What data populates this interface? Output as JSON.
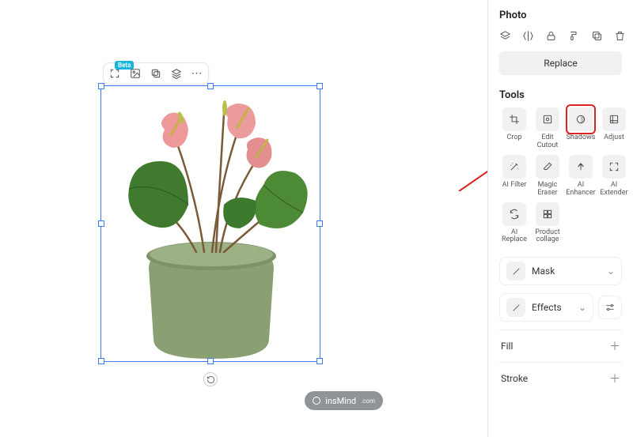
{
  "panel": {
    "title": "Photo",
    "replace_label": "Replace",
    "tools_label": "Tools",
    "mask_label": "Mask",
    "effects_label": "Effects",
    "fill_label": "Fill",
    "stroke_label": "Stroke"
  },
  "top_icons": [
    {
      "name": "layers-icon"
    },
    {
      "name": "flip-icon"
    },
    {
      "name": "lock-icon"
    },
    {
      "name": "paint-icon"
    },
    {
      "name": "duplicate-icon"
    },
    {
      "name": "delete-icon"
    }
  ],
  "tools": [
    {
      "name": "crop",
      "label": "Crop",
      "icon": "crop"
    },
    {
      "name": "edit-cutout",
      "label": "Edit\nCutout",
      "icon": "edit"
    },
    {
      "name": "shadows",
      "label": "Shadows",
      "icon": "shadows",
      "highlight": true
    },
    {
      "name": "adjust",
      "label": "Adjust",
      "icon": "adjust"
    },
    {
      "name": "ai-filter",
      "label": "AI Filter",
      "icon": "wand"
    },
    {
      "name": "magic-eraser",
      "label": "Magic\nEraser",
      "icon": "eraser"
    },
    {
      "name": "ai-enhancer",
      "label": "AI\nEnhancer",
      "icon": "enhance"
    },
    {
      "name": "ai-extender",
      "label": "AI\nExtender",
      "icon": "extend"
    },
    {
      "name": "ai-replace",
      "label": "AI\nReplace",
      "icon": "replace"
    },
    {
      "name": "product-collage",
      "label": "Product\ncollage",
      "icon": "collage"
    }
  ],
  "floating_toolbar": {
    "badge": "Beta",
    "items": [
      {
        "name": "ai-expand-icon"
      },
      {
        "name": "image-icon"
      },
      {
        "name": "copy-icon"
      },
      {
        "name": "layers2-icon"
      },
      {
        "name": "more-icon"
      }
    ]
  },
  "watermark": {
    "text": "insMind",
    "suffix": ".com"
  },
  "annotation": {
    "target_tool": "shadows",
    "color": "#d22"
  }
}
